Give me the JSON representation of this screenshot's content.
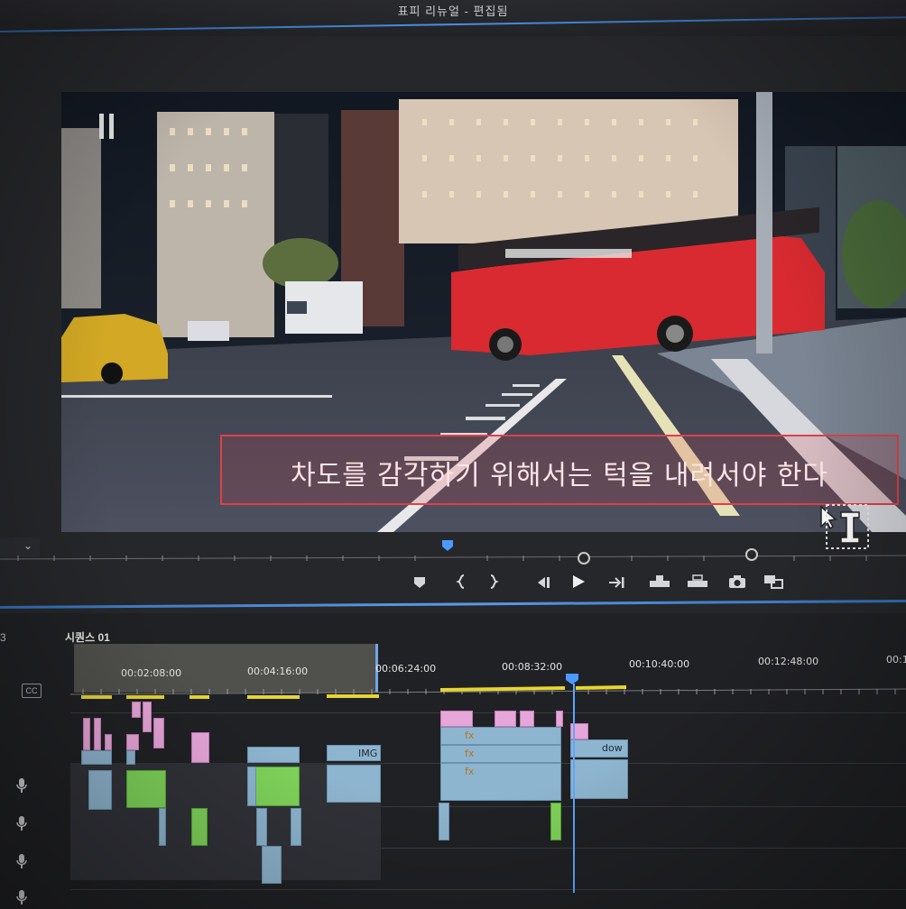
{
  "window": {
    "title": "표피 리뉴얼 - 편집됨"
  },
  "program_monitor": {
    "caption": "차도를 감각하기 위해서는 턱을 내려서야 한다",
    "playback_state": "paused",
    "transport_icons": [
      "add-marker-icon",
      "mark-in-icon",
      "mark-out-icon",
      "step-back-icon",
      "play-icon",
      "step-forward-icon",
      "insert-icon",
      "overwrite-icon",
      "export-frame-icon",
      "compare-view-icon"
    ]
  },
  "timeline": {
    "panel_number": "3",
    "sequence_name": "시퀀스 01",
    "cc_label": "CC",
    "timecodes": [
      "00:02:08:00",
      "00:04:16:00",
      "00:06:24:00",
      "00:08:32:00",
      "00:10:40:00",
      "00:12:48:00",
      "00:1"
    ],
    "clips": {
      "img_label": "IMG",
      "dow_label": "dow",
      "fx_label": "fx"
    }
  },
  "colors": {
    "accent_blue": "#4a8fe0",
    "caption_red": "#e0404a",
    "video_clip_pink": "#e7a6d9",
    "video_clip_blue": "#8eb5cf",
    "audio_clip_green": "#7fd35a",
    "playhead_blue": "#5aa6ff"
  }
}
